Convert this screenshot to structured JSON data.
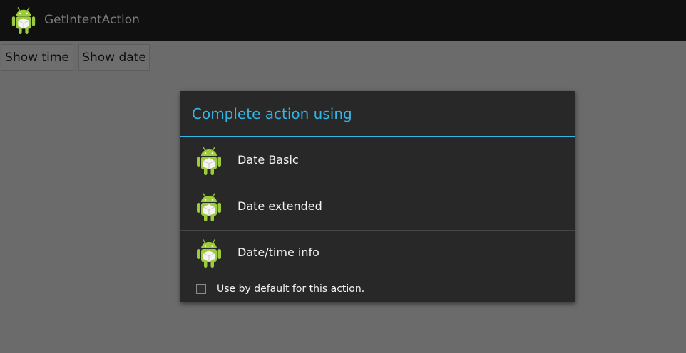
{
  "action_bar": {
    "app_title": "GetIntentAction",
    "app_icon": "android-robot-icon"
  },
  "buttons": {
    "show_time": "Show time",
    "show_date": "Show date"
  },
  "dialog": {
    "title": "Complete action using",
    "items": [
      {
        "label": "Date Basic",
        "icon": "android-robot-icon"
      },
      {
        "label": "Date extended",
        "icon": "android-robot-icon"
      },
      {
        "label": "Date/time info",
        "icon": "android-robot-icon"
      }
    ],
    "default_checkbox_label": "Use by default for this action.",
    "default_checked": false
  },
  "colors": {
    "accent": "#33b5e5",
    "dialog_bg": "#282828",
    "android_green": "#a4c639"
  }
}
